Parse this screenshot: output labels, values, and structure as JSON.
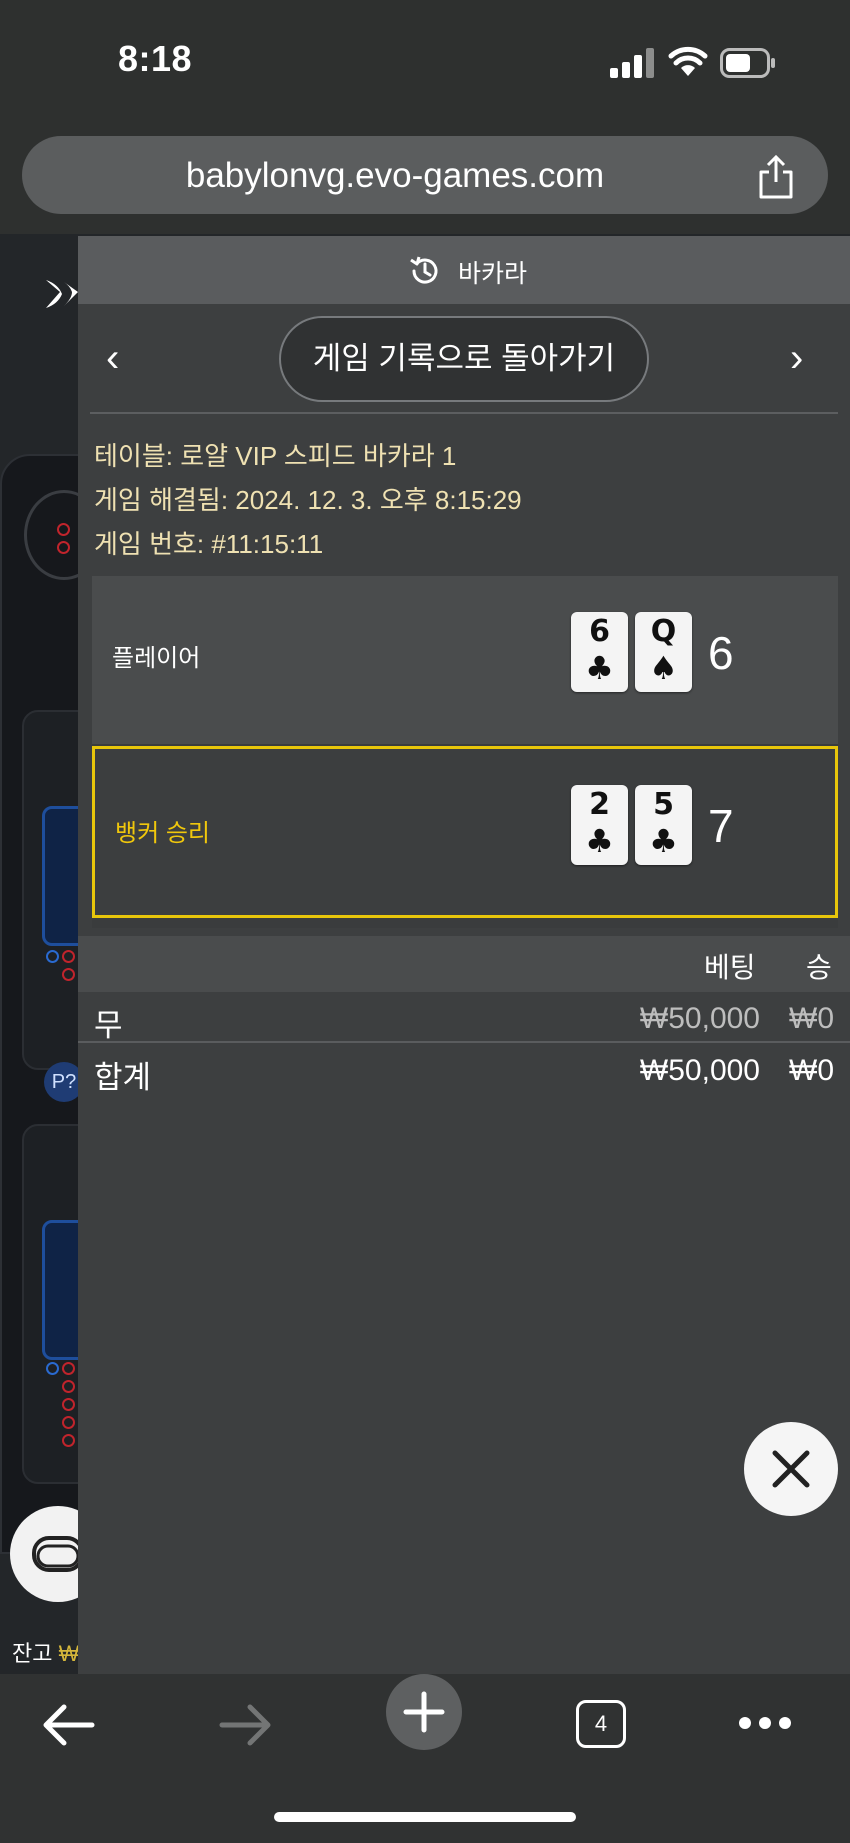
{
  "status_bar": {
    "time": "8:18"
  },
  "browser": {
    "url": "babylonvg.evo-games.com",
    "tab_count": "4"
  },
  "background_page": {
    "badge": "P?",
    "balance_label": "잔고",
    "balance_value": "₩"
  },
  "history": {
    "header_title": "바카라",
    "back_label": "게임 기록으로 돌아가기",
    "table_line": "테이블: 로얄 VIP 스피드 바카라 1",
    "resolved_line": "게임 해결됨: 2024. 12. 3. 오후 8:15:29",
    "game_number_line": "게임 번호: #11:15:11",
    "player": {
      "label": "플레이어",
      "cards": [
        {
          "rank": "6",
          "suit": "♣"
        },
        {
          "rank": "Q",
          "suit": "♠"
        }
      ],
      "score": "6"
    },
    "banker": {
      "label": "뱅커 승리",
      "cards": [
        {
          "rank": "2",
          "suit": "♣"
        },
        {
          "rank": "5",
          "suit": "♣"
        }
      ],
      "score": "7"
    },
    "bets_columns": {
      "bet": "베팅",
      "win": "승"
    },
    "bets": [
      {
        "name": "무",
        "stake": "₩50,000",
        "payout": "₩0"
      },
      {
        "name": "합계",
        "stake": "₩50,000",
        "payout": "₩0"
      }
    ]
  },
  "colors": {
    "win_highlight": "#e8c60b",
    "info_text": "#efe1b2",
    "muted_amount": "#bdbdbd"
  }
}
